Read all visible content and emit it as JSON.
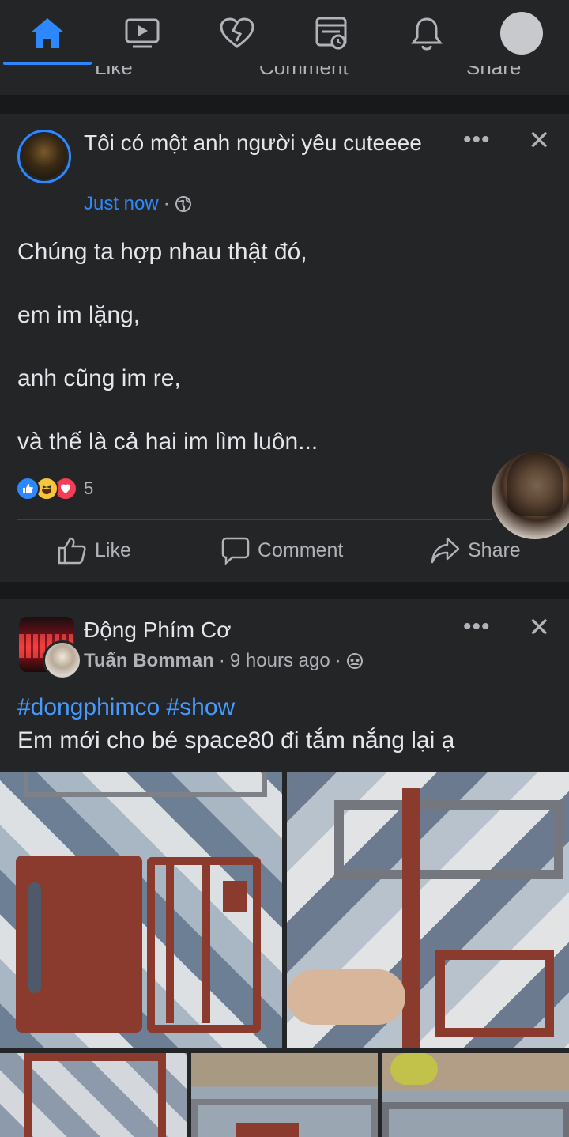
{
  "colors": {
    "background": "#18191a",
    "card": "#242526",
    "accent": "#2d88ff",
    "secondary_text": "#b0b3b8",
    "primary_text": "#e4e6eb"
  },
  "nav": {
    "tabs": [
      {
        "name": "home",
        "icon": "home-icon",
        "active": true
      },
      {
        "name": "watch",
        "icon": "video-icon"
      },
      {
        "name": "dating",
        "icon": "heart-icon"
      },
      {
        "name": "news",
        "icon": "news-feed-icon"
      },
      {
        "name": "notifications",
        "icon": "bell-icon"
      },
      {
        "name": "profile",
        "icon": "avatar"
      }
    ]
  },
  "prev_post": {
    "like_label": "Like",
    "comment_label": "Comment",
    "share_label": "Share"
  },
  "post1": {
    "author": "Tôi có một anh người yêu cuteeee",
    "time": "Just now",
    "privacy_icon": "globe-icon",
    "lines": [
      "Chúng ta hợp nhau thật đó,",
      "em im lặng,",
      "anh cũng im re,",
      "và thế là cả hai im lìm luôn..."
    ],
    "reaction_count": "5",
    "reaction_icons": [
      "like-reaction-icon",
      "haha-reaction-icon",
      "love-reaction-icon"
    ],
    "like_label": "Like",
    "comment_label": "Comment",
    "share_label": "Share",
    "more_label": "•••",
    "close_label": "✕"
  },
  "post2": {
    "group": "Động Phím Cơ",
    "author": "Tuấn Bomman",
    "time": "9 hours ago",
    "privacy_icon": "group-icon",
    "hashtags": "#dongphimco #show",
    "text": "Em mới cho bé space80 đi tắm nắng lại ạ",
    "more_label": "•••",
    "close_label": "✕"
  }
}
